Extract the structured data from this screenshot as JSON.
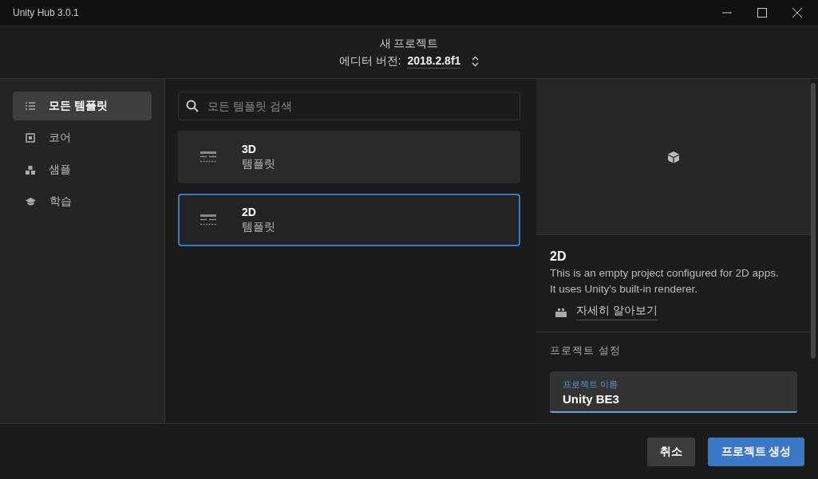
{
  "window": {
    "title": "Unity Hub 3.0.1"
  },
  "header": {
    "title": "새 프로젝트",
    "editor_version_label": "에디터 버전:",
    "editor_version": "2018.2.8f1"
  },
  "sidebar": {
    "items": [
      {
        "kind": "list",
        "label": "모든 템플릿",
        "selected": true
      },
      {
        "kind": "core",
        "label": "코어",
        "selected": false
      },
      {
        "kind": "sample",
        "label": "샘플",
        "selected": false
      },
      {
        "kind": "learn",
        "label": "학습",
        "selected": false
      }
    ]
  },
  "search": {
    "placeholder": "모든 템플릿 검색"
  },
  "templates": [
    {
      "name": "3D",
      "type": "템플릿",
      "selected": false
    },
    {
      "name": "2D",
      "type": "템플릿",
      "selected": true
    }
  ],
  "details": {
    "name": "2D",
    "description": "This is an empty project configured for 2D apps. It uses Unity's built-in renderer.",
    "learn_more": "자세히 알아보기"
  },
  "settings": {
    "heading": "프로젝트 설정",
    "name_field": {
      "label": "프로젝트 이름",
      "value": "Unity BE3"
    }
  },
  "buttons": {
    "cancel": "취소",
    "create": "프로젝트 생성"
  }
}
